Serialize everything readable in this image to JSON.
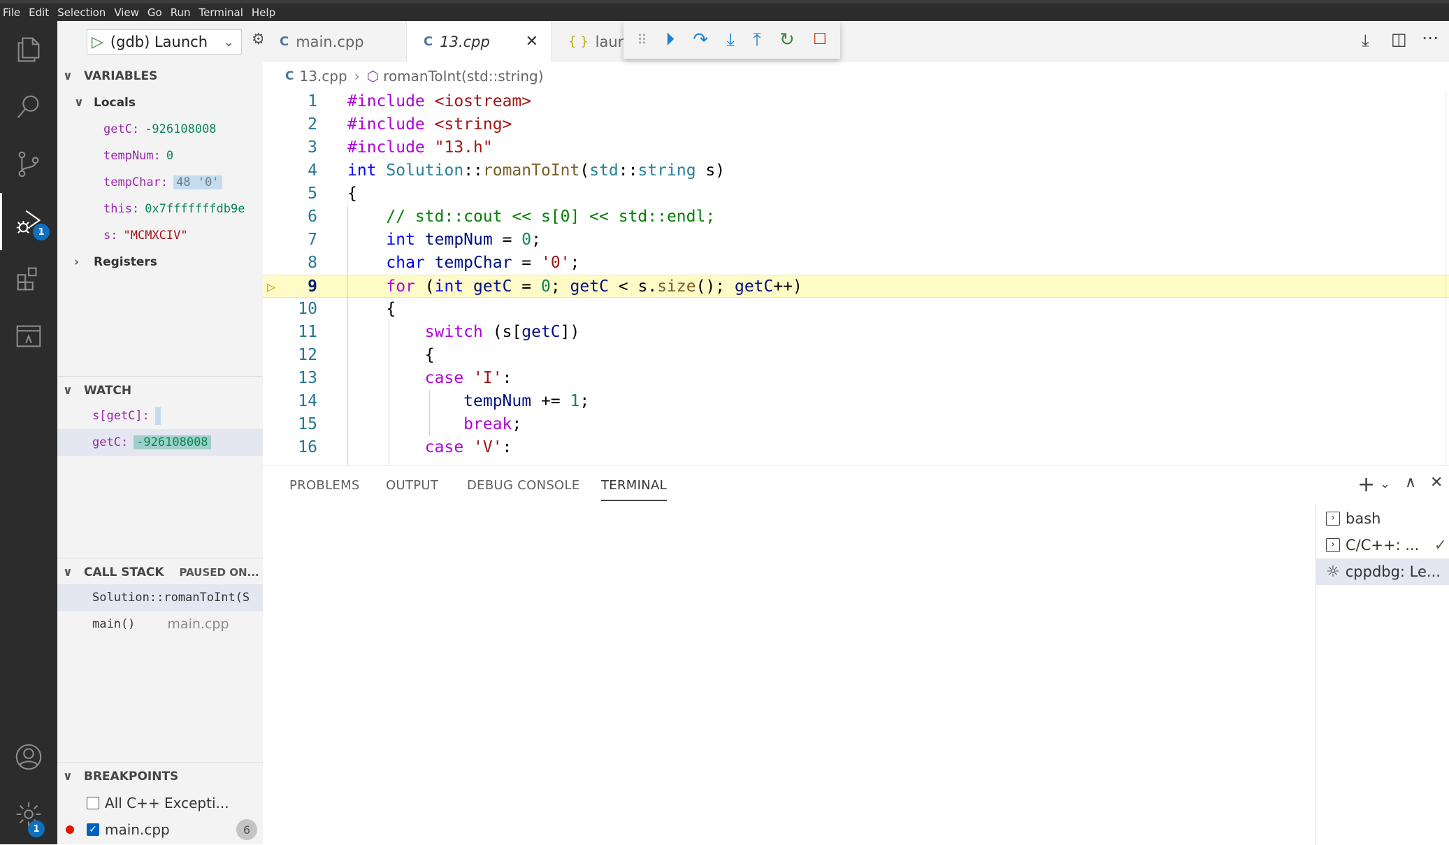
{
  "menu": [
    "File",
    "Edit",
    "Selection",
    "View",
    "Go",
    "Run",
    "Terminal",
    "Help"
  ],
  "activity": {
    "debug_badge": "1",
    "settings_badge": "1"
  },
  "debug": {
    "config": "(gdb) Launch"
  },
  "variables": {
    "title": "VARIABLES",
    "locals_label": "Locals",
    "items": [
      {
        "name": "getC:",
        "value": "-926108008"
      },
      {
        "name": "tempNum:",
        "value": "0"
      },
      {
        "name": "tempChar:",
        "value": "48 '0'"
      },
      {
        "name": "this:",
        "value": "0x7fffffffdb9e"
      },
      {
        "name": "s:",
        "value": "\"MCMXCIV\""
      }
    ],
    "registers_label": "Registers"
  },
  "watch": {
    "title": "WATCH",
    "items": [
      {
        "name": "s[getC]:",
        "value": ""
      },
      {
        "name": "getC:",
        "value": "-926108008"
      }
    ]
  },
  "callstack": {
    "title": "CALL STACK",
    "status": "PAUSED ON...",
    "frames": [
      {
        "fn": "Solution::romanToInt(S",
        "file": ""
      },
      {
        "fn": "main()",
        "file": "main.cpp"
      }
    ]
  },
  "breakpoints": {
    "title": "BREAKPOINTS",
    "items": [
      {
        "label": "All C++ Excepti...",
        "checked": false
      },
      {
        "label": "main.cpp",
        "checked": true,
        "count": "6"
      }
    ]
  },
  "tabs": [
    {
      "label": "main.cpp",
      "icon": "cpp"
    },
    {
      "label": "13.cpp",
      "icon": "cpp"
    },
    {
      "label": "laun",
      "icon": "json",
      "icon_text": "{ }"
    }
  ],
  "breadcrumb": {
    "file": "13.cpp",
    "symbol": "romanToInt(std::string)"
  },
  "code": [
    {
      "n": "1",
      "t": "#include <iostream>"
    },
    {
      "n": "2",
      "t": "#include <string>"
    },
    {
      "n": "3",
      "t": "#include \"13.h\""
    },
    {
      "n": "4",
      "t": "int Solution::romanToInt(std::string s)"
    },
    {
      "n": "5",
      "t": "{"
    },
    {
      "n": "6",
      "t": "    // std::cout << s[0] << std::endl;"
    },
    {
      "n": "7",
      "t": "    int tempNum = 0;"
    },
    {
      "n": "8",
      "t": "    char tempChar = '0';"
    },
    {
      "n": "9",
      "t": "    for (int getC = 0; getC < s.size(); getC++)"
    },
    {
      "n": "10",
      "t": "    {"
    },
    {
      "n": "11",
      "t": "        switch (s[getC])"
    },
    {
      "n": "12",
      "t": "        {"
    },
    {
      "n": "13",
      "t": "        case 'I':"
    },
    {
      "n": "14",
      "t": "            tempNum += 1;"
    },
    {
      "n": "15",
      "t": "            break;"
    },
    {
      "n": "16",
      "t": "        case 'V':"
    }
  ],
  "panel": {
    "tabs": [
      "PROBLEMS",
      "OUTPUT",
      "DEBUG CONSOLE",
      "TERMINAL"
    ],
    "terminals": [
      "bash",
      "C/C++: ...",
      "cppdbg: Le..."
    ]
  }
}
